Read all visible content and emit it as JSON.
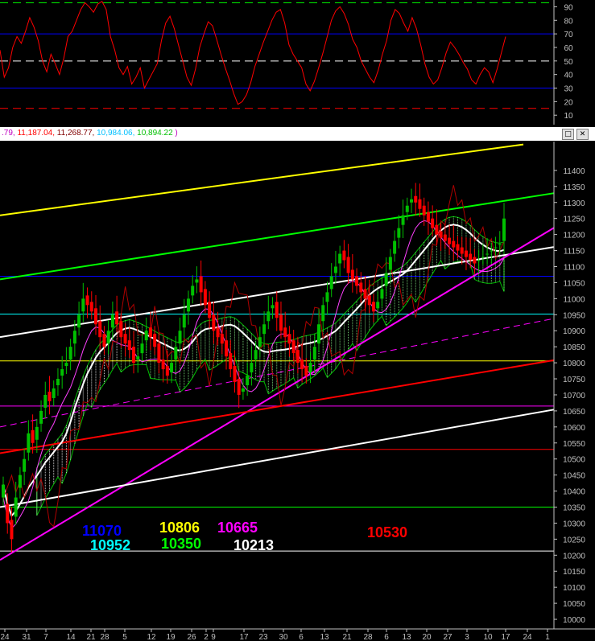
{
  "title_values": [
    {
      "text": ".79, ",
      "color": "#c000c0"
    },
    {
      "text": "11,187.04, ",
      "color": "#ff0000"
    },
    {
      "text": "11,268.77, ",
      "color": "#800000"
    },
    {
      "text": "10,984.06, ",
      "color": "#00c0ff"
    },
    {
      "text": "10,894.22",
      "color": "#00c000"
    },
    {
      "text": " )",
      "color": "#c000c0"
    }
  ],
  "window_buttons": {
    "restore": "□",
    "close": "✕"
  },
  "chart_data": [
    {
      "type": "line",
      "panel": "rsi",
      "ylim": [
        3,
        95
      ],
      "yticks": [
        "90",
        "80",
        "70",
        "60",
        "50",
        "40",
        "30",
        "20",
        "10"
      ],
      "hlines": [
        {
          "value": 93,
          "color": "#00ff00",
          "style": "dashed"
        },
        {
          "value": 70,
          "color": "#0000ff",
          "style": "solid"
        },
        {
          "value": 50,
          "color": "#ffffff",
          "style": "dashed"
        },
        {
          "value": 30,
          "color": "#0000ff",
          "style": "solid"
        },
        {
          "value": 15,
          "color": "#ff0000",
          "style": "dashed"
        }
      ],
      "series": [
        {
          "color": "#ff0000",
          "values": [
            58,
            38,
            45,
            60,
            68,
            63,
            72,
            82,
            75,
            65,
            50,
            42,
            55,
            48,
            40,
            52,
            68,
            72,
            80,
            88,
            93,
            90,
            86,
            92,
            94,
            88,
            68,
            58,
            45,
            40,
            46,
            33,
            38,
            45,
            30,
            36,
            42,
            48,
            65,
            78,
            83,
            74,
            62,
            50,
            38,
            32,
            44,
            60,
            70,
            79,
            76,
            66,
            55,
            45,
            36,
            26,
            18,
            20,
            25,
            34,
            46,
            55,
            64,
            72,
            80,
            86,
            88,
            78,
            62,
            55,
            50,
            45,
            33,
            28,
            35,
            45,
            56,
            68,
            80,
            87,
            90,
            85,
            77,
            66,
            60,
            50,
            44,
            38,
            34,
            43,
            55,
            65,
            80,
            88,
            85,
            78,
            72,
            82,
            74,
            62,
            48,
            38,
            33,
            36,
            45,
            56,
            64,
            60,
            55,
            49,
            44,
            36,
            33,
            40,
            45,
            42,
            34,
            44,
            56,
            68
          ]
        }
      ]
    },
    {
      "type": "candlestick",
      "panel": "price",
      "ylim": [
        9970,
        11490
      ],
      "yticks": [
        "11400",
        "11350",
        "11300",
        "11250",
        "11200",
        "11150",
        "11100",
        "11050",
        "11000",
        "10950",
        "10900",
        "10850",
        "10800",
        "10750",
        "10700",
        "10650",
        "10600",
        "10550",
        "10500",
        "10450",
        "10400",
        "10350",
        "10300",
        "10250",
        "10200",
        "10150",
        "10100",
        "10050",
        "10000"
      ],
      "xticks": [
        "24",
        "31",
        "7",
        "14",
        "21",
        "28",
        "5",
        "12",
        "19",
        "26",
        "2",
        "9",
        "17",
        "23",
        "30",
        "6",
        "13",
        "21",
        "28",
        "6",
        "13",
        "20",
        "27",
        "3",
        "10",
        "17",
        "24",
        "1"
      ],
      "levels": [
        {
          "value": 11070,
          "color": "#0000ff",
          "label": "11070"
        },
        {
          "value": 10952,
          "color": "#00ffff",
          "label": "10952"
        },
        {
          "value": 10806,
          "color": "#ffff00",
          "label": "10806"
        },
        {
          "value": 10350,
          "color": "#00ff00",
          "label": "10350"
        },
        {
          "value": 10665,
          "color": "#ff00ff",
          "label": "10665"
        },
        {
          "value": 10213,
          "color": "#ffffff",
          "label": "10213"
        },
        {
          "value": 10530,
          "color": "#ff0000",
          "label": "10530"
        }
      ],
      "trendlines": [
        {
          "color": "#ffff00",
          "from": [
            0,
            11260
          ],
          "to": [
            650,
            11481
          ]
        },
        {
          "color": "#00ff00",
          "from": [
            0,
            11060
          ],
          "to": [
            688,
            11329
          ]
        },
        {
          "color": "#ffffff",
          "from": [
            0,
            10880
          ],
          "to": [
            688,
            11161
          ]
        },
        {
          "color": "#ff00ff",
          "from": [
            0,
            10185
          ],
          "to": [
            688,
            11221
          ]
        },
        {
          "color": "#ff0000",
          "from": [
            0,
            10518
          ],
          "to": [
            688,
            10808
          ]
        },
        {
          "color": "#ffffff",
          "from": [
            0,
            10350
          ],
          "to": [
            688,
            10654
          ]
        },
        {
          "color": "#ff00ff",
          "from": [
            0,
            10600
          ],
          "to": [
            688,
            10938
          ],
          "style": "dashed"
        }
      ],
      "close": [
        10420,
        10300,
        10250,
        10380,
        10450,
        10500,
        10580,
        10550,
        10600,
        10650,
        10700,
        10680,
        10720,
        10750,
        10780,
        10800,
        10850,
        10900,
        10950,
        11000,
        10980,
        10960,
        10920,
        10880,
        10850,
        10900,
        10950,
        10920,
        10880,
        10860,
        10840,
        10800,
        10820,
        10860,
        10900,
        10880,
        10850,
        10800,
        10780,
        10760,
        10800,
        10850,
        10900,
        10950,
        11000,
        11040,
        11060,
        11020,
        10980,
        10940,
        10900,
        10880,
        10860,
        10820,
        10780,
        10740,
        10700,
        10720,
        10760,
        10800,
        10840,
        10880,
        10920,
        10960,
        10980,
        10940,
        10900,
        10880,
        10860,
        10830,
        10800,
        10780,
        10760,
        10800,
        10850,
        10920,
        10980,
        11020,
        11070,
        11100,
        11140,
        11120,
        11080,
        11060,
        11040,
        11020,
        11000,
        10980,
        10960,
        10990,
        11030,
        11080,
        11130,
        11180,
        11220,
        11260,
        11290,
        11310,
        11300,
        11280,
        11260,
        11240,
        11220,
        11200,
        11190,
        11180,
        11170,
        11160,
        11150,
        11140,
        11130,
        11120,
        11110,
        11120,
        11130,
        11140,
        11150,
        11160,
        11170,
        11250
      ],
      "open": [
        10380,
        10360,
        10310,
        10320,
        10410,
        10460,
        10520,
        10590,
        10560,
        10610,
        10660,
        10710,
        10690,
        10730,
        10760,
        10790,
        10810,
        10860,
        10910,
        10960,
        11010,
        10990,
        10970,
        10930,
        10890,
        10860,
        10910,
        10960,
        10930,
        10890,
        10870,
        10850,
        10810,
        10830,
        10870,
        10910,
        10890,
        10860,
        10810,
        10790,
        10770,
        10810,
        10860,
        10910,
        10960,
        11010,
        11050,
        11070,
        11030,
        10990,
        10950,
        10910,
        10890,
        10870,
        10830,
        10790,
        10750,
        10710,
        10730,
        10770,
        10810,
        10850,
        10890,
        10930,
        10970,
        10990,
        10950,
        10910,
        10890,
        10870,
        10840,
        10810,
        10790,
        10770,
        10810,
        10860,
        10930,
        10990,
        11030,
        11080,
        11110,
        11150,
        11130,
        11090,
        11070,
        11050,
        11030,
        11010,
        10990,
        10970,
        11000,
        11040,
        11090,
        11140,
        11190,
        11230,
        11270,
        11300,
        11320,
        11310,
        11290,
        11270,
        11250,
        11230,
        11210,
        11200,
        11190,
        11180,
        11170,
        11160,
        11150,
        11140,
        11130,
        11120,
        11130,
        11140,
        11150,
        11160,
        11170,
        11180
      ]
    }
  ]
}
